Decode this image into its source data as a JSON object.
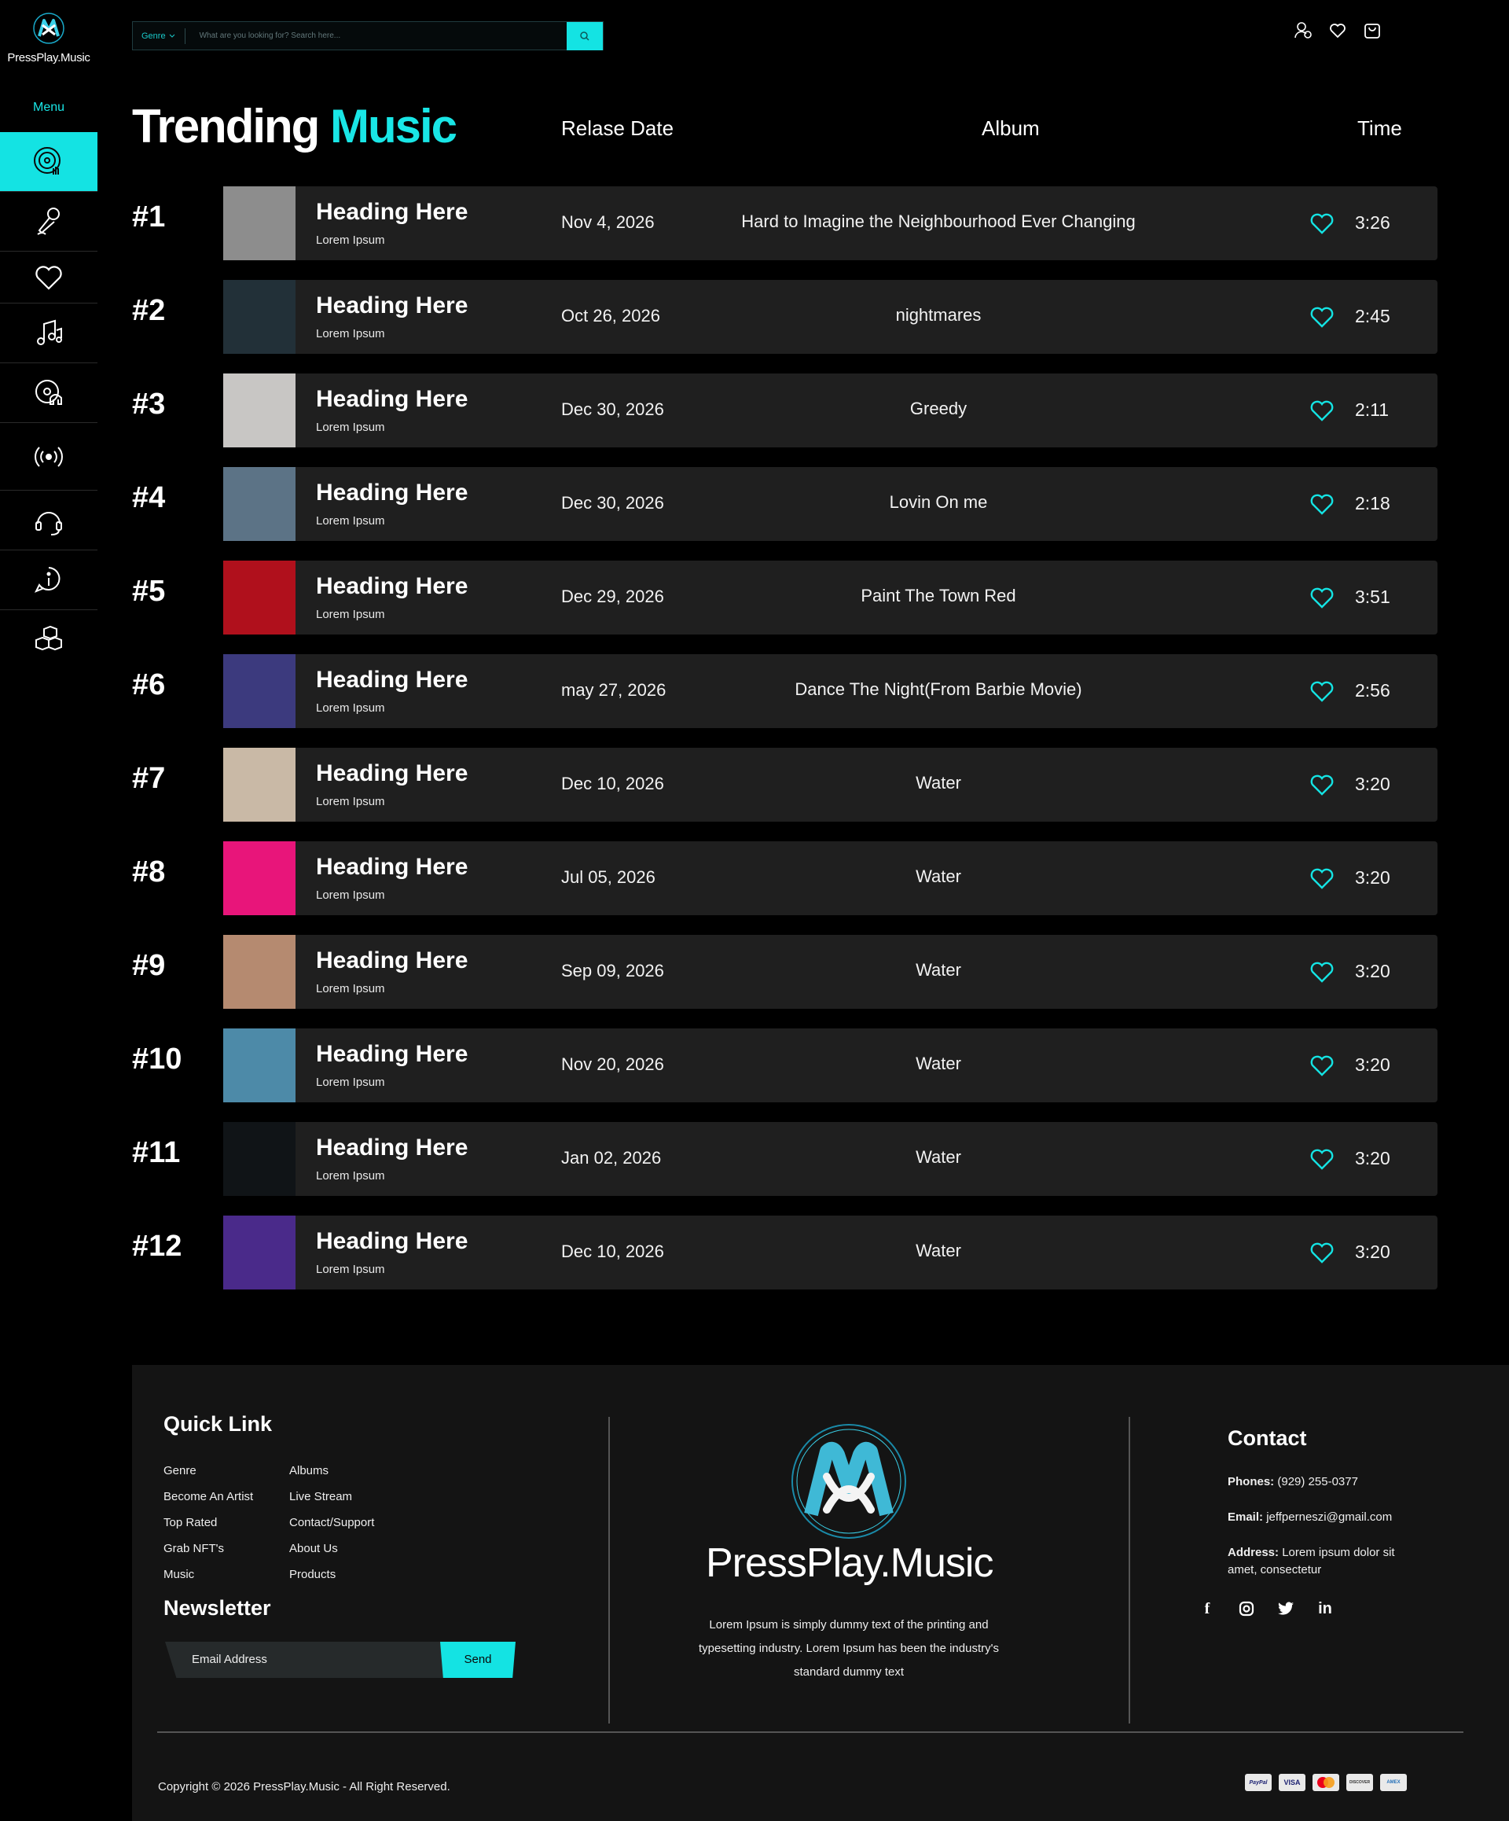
{
  "brand": {
    "name": "PressPlay.Music",
    "accent": "#14e3e3"
  },
  "sidebar": {
    "menu_label": "Menu",
    "items": [
      {
        "icon": "vinyl-icon"
      },
      {
        "icon": "microphone-icon"
      },
      {
        "icon": "heart-icon"
      },
      {
        "icon": "music-notes-icon"
      },
      {
        "icon": "headphones-disc-icon"
      },
      {
        "icon": "broadcast-icon"
      },
      {
        "icon": "headset-icon"
      },
      {
        "icon": "info-icon"
      },
      {
        "icon": "boxes-icon"
      }
    ]
  },
  "search": {
    "genre_label": "Genre",
    "placeholder": "What are you looking for? Search here...",
    "button_icon": "search-icon"
  },
  "header_icons": [
    "user-icon",
    "wishlist-heart-icon",
    "cart-icon"
  ],
  "page": {
    "title_main": "Trending",
    "title_accent": "Music"
  },
  "columns": {
    "release": "Relase Date",
    "album": "Album",
    "time": "Time"
  },
  "tracks": [
    {
      "rank": "#1",
      "heading": "Heading Here",
      "sub": "Lorem Ipsum",
      "date": "Nov 4, 2026",
      "album": "Hard to Imagine the Neighbourhood Ever Changing",
      "time": "3:26",
      "thumb_color": "#8d8d8d"
    },
    {
      "rank": "#2",
      "heading": "Heading Here",
      "sub": "Lorem Ipsum",
      "date": "Oct 26, 2026",
      "album": "nightmares",
      "time": "2:45",
      "thumb_color": "#223038"
    },
    {
      "rank": "#3",
      "heading": "Heading Here",
      "sub": "Lorem Ipsum",
      "date": "Dec 30, 2026",
      "album": "Greedy",
      "time": "2:11",
      "thumb_color": "#c8c6c4"
    },
    {
      "rank": "#4",
      "heading": "Heading Here",
      "sub": "Lorem Ipsum",
      "date": "Dec 30, 2026",
      "album": "Lovin On me",
      "time": "2:18",
      "thumb_color": "#5c7386"
    },
    {
      "rank": "#5",
      "heading": "Heading Here",
      "sub": "Lorem Ipsum",
      "date": "Dec 29, 2026",
      "album": "Paint The Town Red",
      "time": "3:51",
      "thumb_color": "#b0101c"
    },
    {
      "rank": "#6",
      "heading": "Heading Here",
      "sub": "Lorem Ipsum",
      "date": "may 27, 2026",
      "album": "Dance The Night(From Barbie Movie)",
      "time": "2:56",
      "thumb_color": "#3c3a7e"
    },
    {
      "rank": "#7",
      "heading": "Heading Here",
      "sub": "Lorem Ipsum",
      "date": "Dec 10, 2026",
      "album": "Water",
      "time": "3:20",
      "thumb_color": "#c9b9a6"
    },
    {
      "rank": "#8",
      "heading": "Heading Here",
      "sub": "Lorem Ipsum",
      "date": "Jul 05, 2026",
      "album": "Water",
      "time": "3:20",
      "thumb_color": "#e8157a"
    },
    {
      "rank": "#9",
      "heading": "Heading Here",
      "sub": "Lorem Ipsum",
      "date": "Sep 09, 2026",
      "album": "Water",
      "time": "3:20",
      "thumb_color": "#b58a70"
    },
    {
      "rank": "#10",
      "heading": "Heading Here",
      "sub": "Lorem Ipsum",
      "date": "Nov 20, 2026",
      "album": "Water",
      "time": "3:20",
      "thumb_color": "#4d8aa8"
    },
    {
      "rank": "#11",
      "heading": "Heading Here",
      "sub": "Lorem Ipsum",
      "date": "Jan 02, 2026",
      "album": "Water",
      "time": "3:20",
      "thumb_color": "#101417"
    },
    {
      "rank": "#12",
      "heading": "Heading Here",
      "sub": "Lorem Ipsum",
      "date": "Dec 10, 2026",
      "album": "Water",
      "time": "3:20",
      "thumb_color": "#4a2a8a"
    }
  ],
  "footer": {
    "quick_link_title": "Quick Link",
    "links_left": [
      "Genre",
      "Become An Artist",
      "Top Rated",
      "Grab NFT's",
      "Music"
    ],
    "links_right": [
      "Albums",
      "Live Stream",
      "Contact/Support",
      "About Us",
      "Products"
    ],
    "newsletter_title": "Newsletter",
    "email_placeholder": "Email Address",
    "send_label": "Send",
    "logo_text": "PressPlay.Music",
    "description": "Lorem Ipsum is simply dummy text of the printing and typesetting industry. Lorem Ipsum has been the industry's standard dummy text",
    "contact_title": "Contact",
    "phone_label": "Phones:",
    "phone": "(929) 255-0377",
    "email_label": "Email:",
    "email": "jeffperneszi@gmail.com",
    "address_label": "Address:",
    "address": "Lorem ipsum dolor sit amet, consectetur",
    "socials": [
      "facebook-icon",
      "instagram-icon",
      "twitter-icon",
      "linkedin-icon"
    ],
    "copyright": "Copyright © 2026 PressPlay.Music - All Right Reserved.",
    "payments": [
      "PayPal",
      "VISA",
      "MC",
      "DISCOVER",
      "AMEX"
    ]
  }
}
